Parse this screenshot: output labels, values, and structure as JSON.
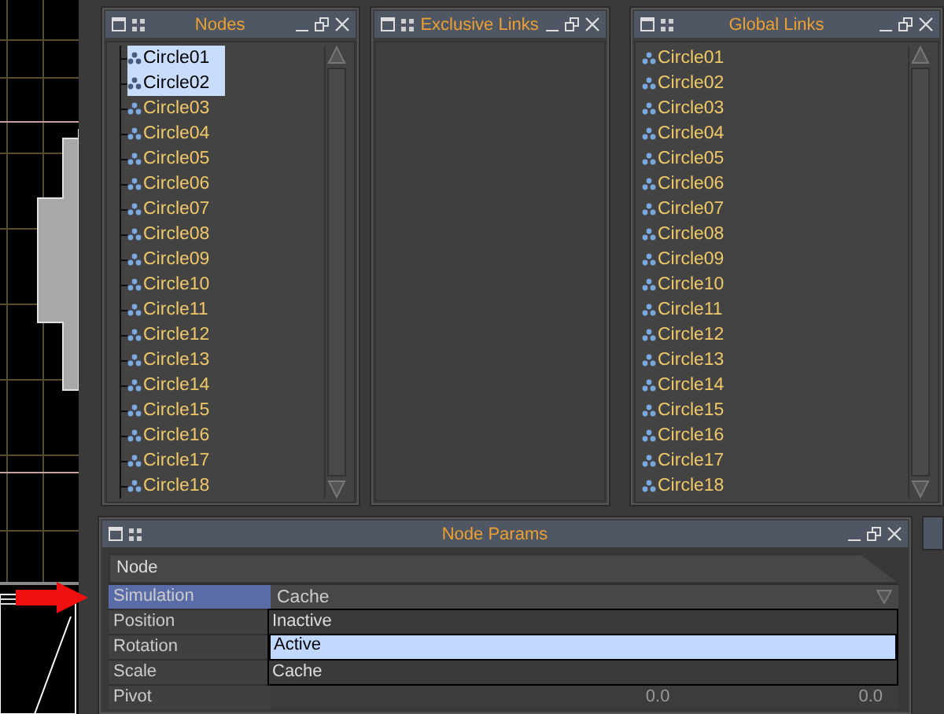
{
  "panels": [
    {
      "title": "Nodes",
      "tree": true,
      "items": [
        {
          "label": "Circle01",
          "selected": true
        },
        {
          "label": "Circle02",
          "selected": true
        },
        {
          "label": "Circle03",
          "selected": false
        },
        {
          "label": "Circle04",
          "selected": false
        },
        {
          "label": "Circle05",
          "selected": false
        },
        {
          "label": "Circle06",
          "selected": false
        },
        {
          "label": "Circle07",
          "selected": false
        },
        {
          "label": "Circle08",
          "selected": false
        },
        {
          "label": "Circle09",
          "selected": false
        },
        {
          "label": "Circle10",
          "selected": false
        },
        {
          "label": "Circle11",
          "selected": false
        },
        {
          "label": "Circle12",
          "selected": false
        },
        {
          "label": "Circle13",
          "selected": false
        },
        {
          "label": "Circle14",
          "selected": false
        },
        {
          "label": "Circle15",
          "selected": false
        },
        {
          "label": "Circle16",
          "selected": false
        },
        {
          "label": "Circle17",
          "selected": false
        },
        {
          "label": "Circle18",
          "selected": false
        }
      ]
    },
    {
      "title": "Exclusive Links",
      "tree": false
    },
    {
      "title": "Global Links",
      "tree": false,
      "items": [
        {
          "label": "Circle01",
          "selected": false
        },
        {
          "label": "Circle02",
          "selected": false
        },
        {
          "label": "Circle03",
          "selected": false
        },
        {
          "label": "Circle04",
          "selected": false
        },
        {
          "label": "Circle05",
          "selected": false
        },
        {
          "label": "Circle06",
          "selected": false
        },
        {
          "label": "Circle07",
          "selected": false
        },
        {
          "label": "Circle08",
          "selected": false
        },
        {
          "label": "Circle09",
          "selected": false
        },
        {
          "label": "Circle10",
          "selected": false
        },
        {
          "label": "Circle11",
          "selected": false
        },
        {
          "label": "Circle12",
          "selected": false
        },
        {
          "label": "Circle13",
          "selected": false
        },
        {
          "label": "Circle14",
          "selected": false
        },
        {
          "label": "Circle15",
          "selected": false
        },
        {
          "label": "Circle16",
          "selected": false
        },
        {
          "label": "Circle17",
          "selected": false
        },
        {
          "label": "Circle18",
          "selected": false
        }
      ]
    }
  ],
  "node_params": {
    "title": "Node Params",
    "header": "Node",
    "rows": [
      {
        "label": "Simulation",
        "selected": true,
        "value": "Cache"
      },
      {
        "label": "Position",
        "selected": false
      },
      {
        "label": "Rotation",
        "selected": false
      },
      {
        "label": "Scale",
        "selected": false
      },
      {
        "label": "Pivot",
        "selected": false,
        "values": [
          "0.0",
          "0.0"
        ]
      }
    ],
    "dropdown": {
      "options": [
        {
          "label": "Inactive",
          "selected": false
        },
        {
          "label": "Active",
          "selected": true
        },
        {
          "label": "Cache",
          "selected": false
        }
      ]
    }
  }
}
